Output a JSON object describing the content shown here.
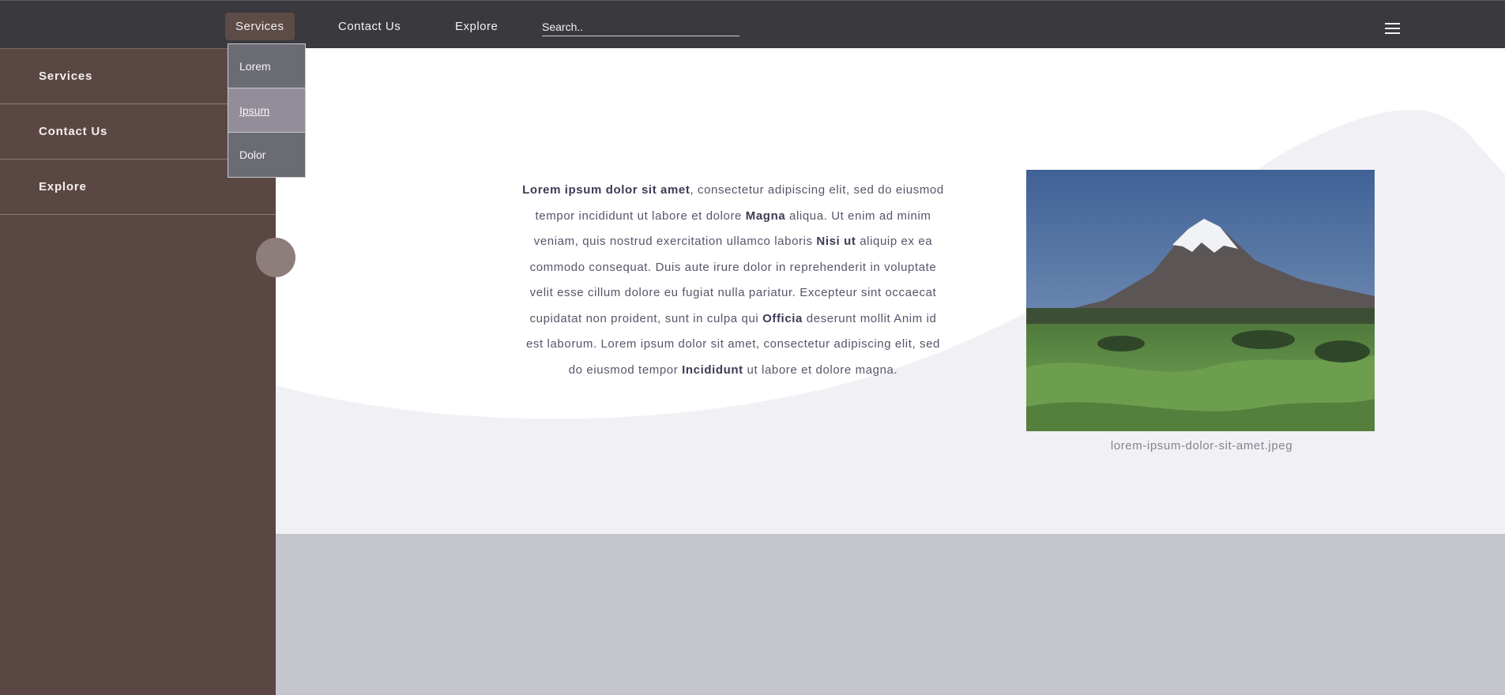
{
  "topbar": {
    "nav": [
      "Services",
      "Contact Us",
      "Explore"
    ],
    "search_placeholder": "Search..",
    "menu_icon": "hamburger-icon"
  },
  "dropdown": {
    "items": [
      "Lorem",
      "Ipsum",
      "Dolor"
    ]
  },
  "sidebar": {
    "items": [
      "Services",
      "Contact Us",
      "Explore"
    ],
    "toggle_icon": "circle-toggle-icon"
  },
  "content": {
    "paragraph": [
      {
        "text": "Lorem ipsum dolor sit amet",
        "bold": true
      },
      {
        "text": ", consectetur adipiscing elit, sed do eiusmod tempor incididunt ut labore et dolore ",
        "bold": false
      },
      {
        "text": "Magna",
        "bold": true
      },
      {
        "text": " aliqua. Ut enim ad minim veniam, quis nostrud exercitation ullamco laboris ",
        "bold": false
      },
      {
        "text": "Nisi ut",
        "bold": true
      },
      {
        "text": " aliquip ex ea commodo consequat. Duis aute irure dolor in reprehenderit in voluptate velit esse cillum dolore eu fugiat nulla pariatur. Excepteur sint occaecat cupidatat non proident, sunt in culpa qui ",
        "bold": false
      },
      {
        "text": "Officia",
        "bold": true
      },
      {
        "text": " deserunt mollit Anim id est laborum. Lorem ipsum dolor sit amet, consectetur adipiscing elit, sed do eiusmod tempor ",
        "bold": false
      },
      {
        "text": "Incididunt",
        "bold": true
      },
      {
        "text": " ut labore et dolore magna.",
        "bold": false
      }
    ],
    "image_caption": "lorem-ipsum-dolor-sit-amet.jpeg"
  },
  "colors": {
    "topbar": "#3a393e",
    "sidebar": "#5a4743",
    "accent_active": "#5c4b47",
    "wave": "#f1f1f5",
    "band": "#c5c5ce"
  }
}
